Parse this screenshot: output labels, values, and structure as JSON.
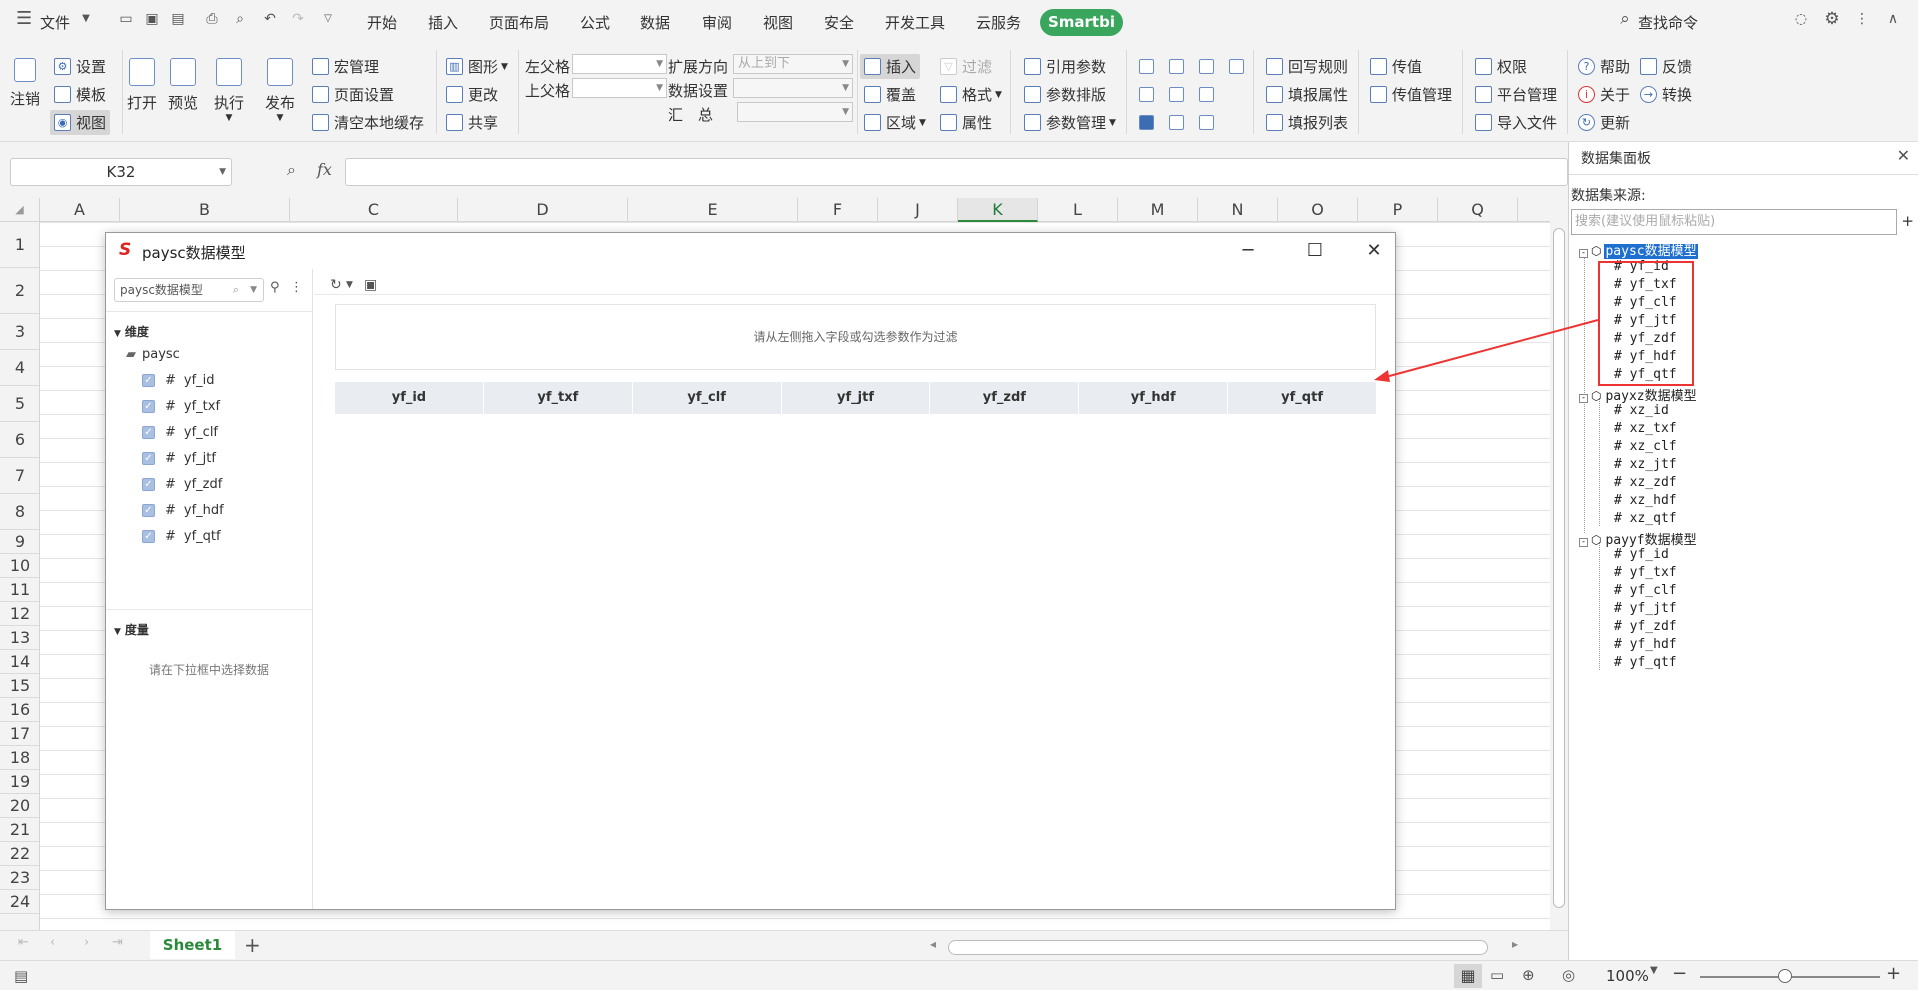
{
  "menubar": {
    "file_label": "文件",
    "tabs": [
      "开始",
      "插入",
      "页面布局",
      "公式",
      "数据",
      "审阅",
      "视图",
      "安全",
      "开发工具",
      "云服务"
    ],
    "smartbi_label": "Smartbi",
    "search_command": "查找命令"
  },
  "ribbon": {
    "logout": "注销",
    "settings": "设置",
    "template": "模板",
    "view": "视图",
    "open": "打开",
    "preview": "预览",
    "execute": "执行",
    "publish": "发布",
    "macro": "宏管理",
    "page_setup": "页面设置",
    "clear_cache": "清空本地缓存",
    "chart": "图形",
    "change": "更改",
    "share": "共享",
    "left_parent": "左父格",
    "top_parent": "上父格",
    "summary": "汇　总",
    "expand_dir": "扩展方向",
    "expand_value": "从上到下",
    "data_setting": "数据设置",
    "insert": "插入",
    "cover": "覆盖",
    "region": "区域",
    "filter": "过滤",
    "format": "格式",
    "attribute": "属性",
    "ref_param": "引用参数",
    "param_layout": "参数排版",
    "param_manage": "参数管理",
    "writeback": "回写规则",
    "fill_attr": "填报属性",
    "fill_list": "填报列表",
    "pass_value": "传值",
    "pass_manage": "传值管理",
    "permission": "权限",
    "platform": "平台管理",
    "import_file": "导入文件",
    "help": "帮助",
    "feedback": "反馈",
    "about": "关于",
    "convert": "转换",
    "update": "更新"
  },
  "formula": {
    "namebox": "K32",
    "fx": "fx"
  },
  "columns": [
    "A",
    "B",
    "C",
    "D",
    "E",
    "F",
    "J",
    "K",
    "L",
    "M",
    "N",
    "O",
    "P",
    "Q"
  ],
  "rows": [
    "1",
    "2",
    "3",
    "4",
    "5",
    "6",
    "7",
    "8",
    "9",
    "10",
    "11",
    "12",
    "13",
    "14",
    "15",
    "16",
    "17",
    "18",
    "19",
    "20",
    "21",
    "22",
    "23",
    "24"
  ],
  "dialog": {
    "title": "paysc数据模型",
    "search_placeholder": "paysc数据模型",
    "dimension_label": "维度",
    "folder": "paysc",
    "fields": [
      "yf_id",
      "yf_txf",
      "yf_clf",
      "yf_jtf",
      "yf_zdf",
      "yf_hdf",
      "yf_qtf"
    ],
    "measure_label": "度量",
    "measure_hint": "请在下拉框中选择数据",
    "filter_hint": "请从左侧拖入字段或勾选参数作为过滤",
    "table_headers": [
      "yf_id",
      "yf_txf",
      "yf_clf",
      "yf_jtf",
      "yf_zdf",
      "yf_hdf",
      "yf_qtf"
    ]
  },
  "panel": {
    "title": "数据集面板",
    "source_label": "数据集来源:",
    "search_placeholder": "搜索(建议使用鼠标粘贴)",
    "models": [
      {
        "name": "paysc数据模型",
        "fields": [
          "yf_id",
          "yf_txf",
          "yf_clf",
          "yf_jtf",
          "yf_zdf",
          "yf_hdf",
          "yf_qtf"
        ]
      },
      {
        "name": "payxz数据模型",
        "fields": [
          "xz_id",
          "xz_txf",
          "xz_clf",
          "xz_jtf",
          "xz_zdf",
          "xz_hdf",
          "xz_qtf"
        ]
      },
      {
        "name": "payyf数据模型",
        "fields": [
          "yf_id",
          "yf_txf",
          "yf_clf",
          "yf_jtf",
          "yf_zdf",
          "yf_hdf",
          "yf_qtf"
        ]
      }
    ]
  },
  "sheets": {
    "active": "Sheet1"
  },
  "status": {
    "zoom": "100%"
  },
  "colors": {
    "smartbi_green": "#3aa55d",
    "selection_blue": "#1e6fd0",
    "annotation_red": "#e33333"
  }
}
